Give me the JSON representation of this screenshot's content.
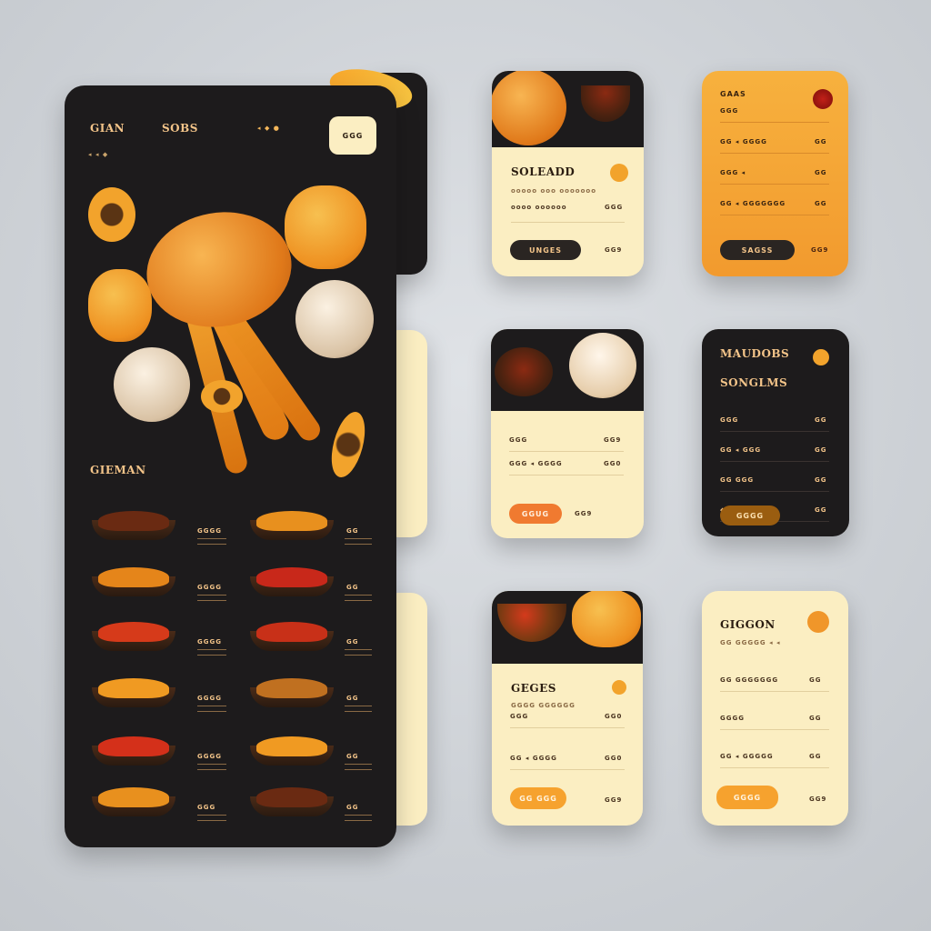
{
  "colors": {
    "dark": "#1d1b1c",
    "cream": "#fbeec2",
    "orange": "#f29a2e",
    "accent_text": "#f3b65a",
    "brown": "#8a5a20"
  },
  "main_screen": {
    "header_left": "GIAN",
    "header_mid": "SOBS",
    "header_icons": "◂ ◆ ●",
    "header_button": "GGG",
    "sub_text": "◂ ◂ ◆",
    "section_title": "GIEMAN",
    "menu_left_prices": [
      "GGGG",
      "GGGG",
      "GGGG",
      "GGGG",
      "GGGG",
      "GGG"
    ],
    "menu_right_prices": [
      "GG",
      "GG",
      "GG",
      "GG",
      "GG",
      "GG"
    ]
  },
  "card_1": {
    "title": "SOLEADD",
    "sub": "ooooo ooo ooooooo",
    "row_label": "oooo oooooo",
    "row_price": "GGG",
    "button": "UNGES",
    "price": "GG9"
  },
  "card_2": {
    "title": "GAAS",
    "rows": [
      {
        "label": "GGG",
        "price": ""
      },
      {
        "label": "GG ◂ GGGG",
        "price": "GG"
      },
      {
        "label": "GGG ◂",
        "price": "GG"
      },
      {
        "label": "GG ◂ GGGGGGG",
        "price": "GG"
      }
    ],
    "button": "SAGSS",
    "price": "GG9"
  },
  "card_3": {
    "rows": [
      {
        "label": "GGG",
        "price": "GG9"
      },
      {
        "label": "GGG ◂ GGGG",
        "price": "GG0"
      }
    ],
    "button": "GGUG",
    "price": "GG9"
  },
  "card_4": {
    "title_1": "MAUDOBS",
    "title_2": "SONGLMS",
    "rows": [
      {
        "label": "GGG",
        "price": "GG"
      },
      {
        "label": "GG ◂ GGG",
        "price": "GG"
      },
      {
        "label": "GG GGG",
        "price": "GG"
      },
      {
        "label": "◆ GGGG",
        "price": "GG"
      }
    ],
    "button": "GGGG"
  },
  "card_5": {
    "title": "GEGES",
    "sub": "GGGG GGGGGG",
    "rows": [
      {
        "label": "GGG",
        "price": "GG0"
      },
      {
        "label": "GG ◂ GGGG",
        "price": "GG0"
      }
    ],
    "button": "GG GGG",
    "price": "GG9"
  },
  "card_6": {
    "title": "GIGGON",
    "sub": "GG GGGGG ◂ ◂",
    "rows": [
      {
        "label": "GG GGGGGGG",
        "price": "GG"
      },
      {
        "label": "GGGG",
        "price": "GG"
      },
      {
        "label": "GG ◂ GGGGG",
        "price": "GG"
      }
    ],
    "button": "GGGG",
    "price": "GG9"
  }
}
